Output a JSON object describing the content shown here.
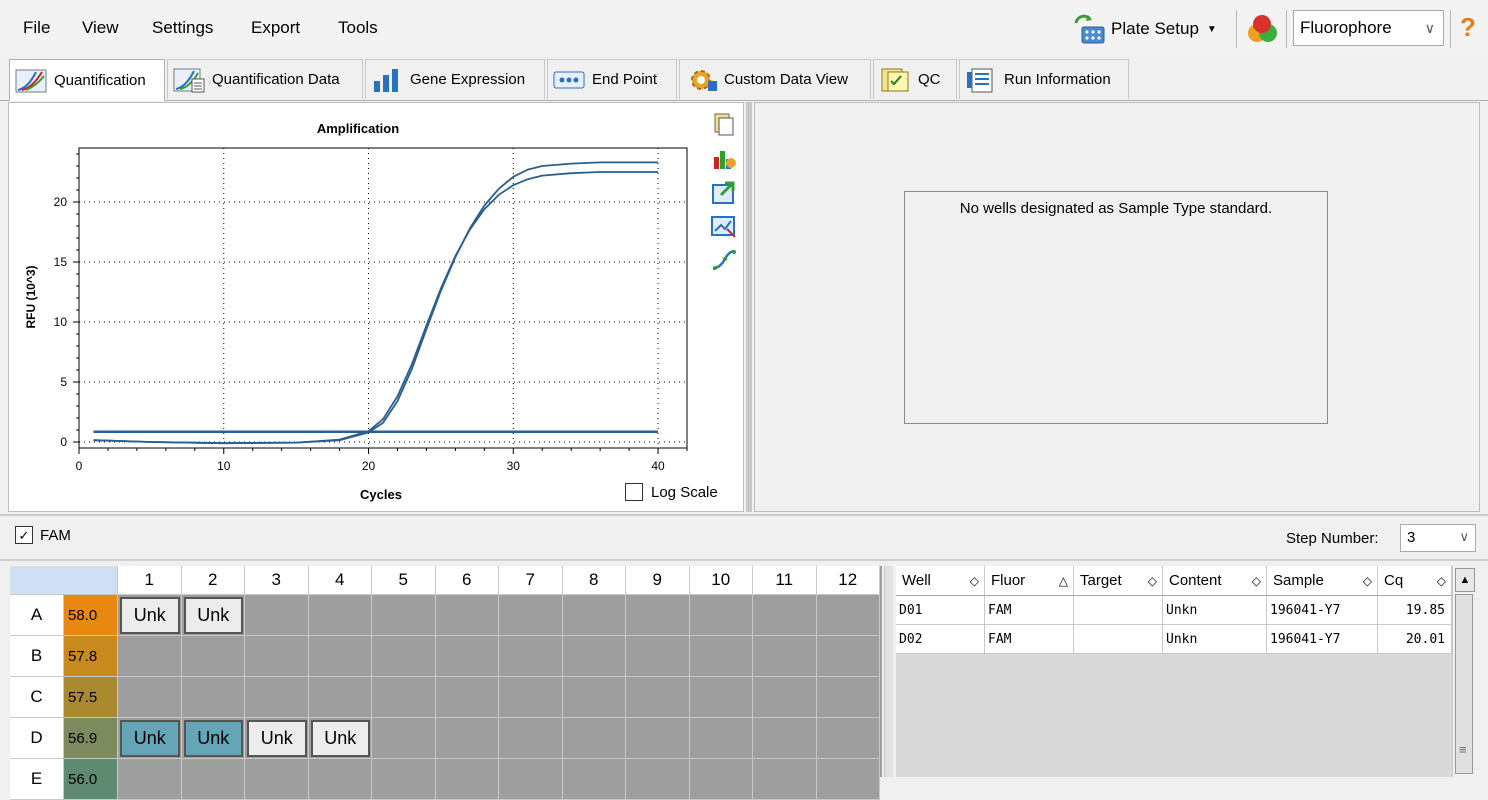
{
  "menu": {
    "file": "File",
    "view": "View",
    "settings": "Settings",
    "export": "Export",
    "tools": "Tools"
  },
  "toolbar": {
    "plate_setup": "Plate Setup",
    "fluorophore": "Fluorophore",
    "help": "?"
  },
  "tabs": [
    "Quantification",
    "Quantification Data",
    "Gene Expression",
    "End Point",
    "Custom Data View",
    "QC",
    "Run Information"
  ],
  "chart_data": {
    "type": "line",
    "title": "Amplification",
    "xlabel": "Cycles",
    "ylabel": "RFU (10^3)",
    "xlim": [
      0,
      42
    ],
    "ylim": [
      -0.5,
      24.5
    ],
    "xticks": [
      "0",
      "10",
      "20",
      "30",
      "40"
    ],
    "yticks": [
      "0",
      "5",
      "10",
      "15",
      "20"
    ],
    "grid": true,
    "series": [
      {
        "x": [
          1,
          5,
          10,
          15,
          18,
          20,
          21,
          22,
          23,
          24,
          25,
          26,
          27,
          28,
          29,
          30,
          31,
          32,
          34,
          36,
          38,
          40
        ],
        "y": [
          0.15,
          0,
          -0.1,
          -0.05,
          0.2,
          0.9,
          1.9,
          3.8,
          6.5,
          9.7,
          12.8,
          15.5,
          17.7,
          19.4,
          20.6,
          21.4,
          21.9,
          22.2,
          22.4,
          22.5,
          22.5,
          22.5
        ]
      },
      {
        "x": [
          1,
          5,
          10,
          15,
          18,
          20,
          21,
          22,
          23,
          24,
          25,
          26,
          27,
          28,
          29,
          30,
          31,
          32,
          34,
          36,
          38,
          40
        ],
        "y": [
          0.15,
          0,
          -0.1,
          -0.05,
          0.15,
          0.8,
          1.6,
          3.4,
          6.1,
          9.4,
          12.6,
          15.4,
          17.8,
          19.7,
          21.1,
          22.1,
          22.7,
          23.0,
          23.2,
          23.3,
          23.3,
          23.3
        ]
      },
      {
        "x": [
          1,
          40
        ],
        "y": [
          0.85,
          0.85
        ]
      }
    ],
    "log_scale_label": "Log Scale"
  },
  "standard_panel": {
    "message": "No wells designated as Sample Type standard."
  },
  "fam": {
    "label": "FAM",
    "step_label": "Step Number:",
    "step_value": "3"
  },
  "plate": {
    "columns": [
      "1",
      "2",
      "3",
      "4",
      "5",
      "6",
      "7",
      "8",
      "9",
      "10",
      "11",
      "12"
    ],
    "rows": [
      {
        "label": "A",
        "temp": "58.0",
        "wells": [
          "Unk",
          "Unk",
          "",
          "",
          "",
          "",
          "",
          "",
          "",
          "",
          "",
          ""
        ]
      },
      {
        "label": "B",
        "temp": "57.8",
        "wells": [
          "",
          "",
          "",
          "",
          "",
          "",
          "",
          "",
          "",
          "",
          "",
          ""
        ]
      },
      {
        "label": "C",
        "temp": "57.5",
        "wells": [
          "",
          "",
          "",
          "",
          "",
          "",
          "",
          "",
          "",
          "",
          "",
          ""
        ]
      },
      {
        "label": "D",
        "temp": "56.9",
        "wells": [
          "Unk",
          "Unk",
          "Unk",
          "Unk",
          "",
          "",
          "",
          "",
          "",
          "",
          "",
          ""
        ]
      },
      {
        "label": "E",
        "temp": "56.0",
        "wells": [
          "",
          "",
          "",
          "",
          "",
          "",
          "",
          "",
          "",
          "",
          "",
          ""
        ]
      }
    ]
  },
  "table": {
    "headers": [
      "Well",
      "Fluor",
      "Target",
      "Content",
      "Sample",
      "Cq"
    ],
    "rows": [
      [
        "D01",
        "FAM",
        "",
        "Unkn",
        "196041-Y7",
        "19.85"
      ],
      [
        "D02",
        "FAM",
        "",
        "Unkn",
        "196041-Y7",
        "20.01"
      ]
    ]
  },
  "colors": {
    "temp_a": "#e9880f",
    "temp_b": "#c98a1d",
    "temp_c": "#a98a2f",
    "temp_d": "#7c8a5d",
    "temp_e": "#5f8a72",
    "curve": "#2b5f8f",
    "selected_well": "#64a5b8"
  }
}
